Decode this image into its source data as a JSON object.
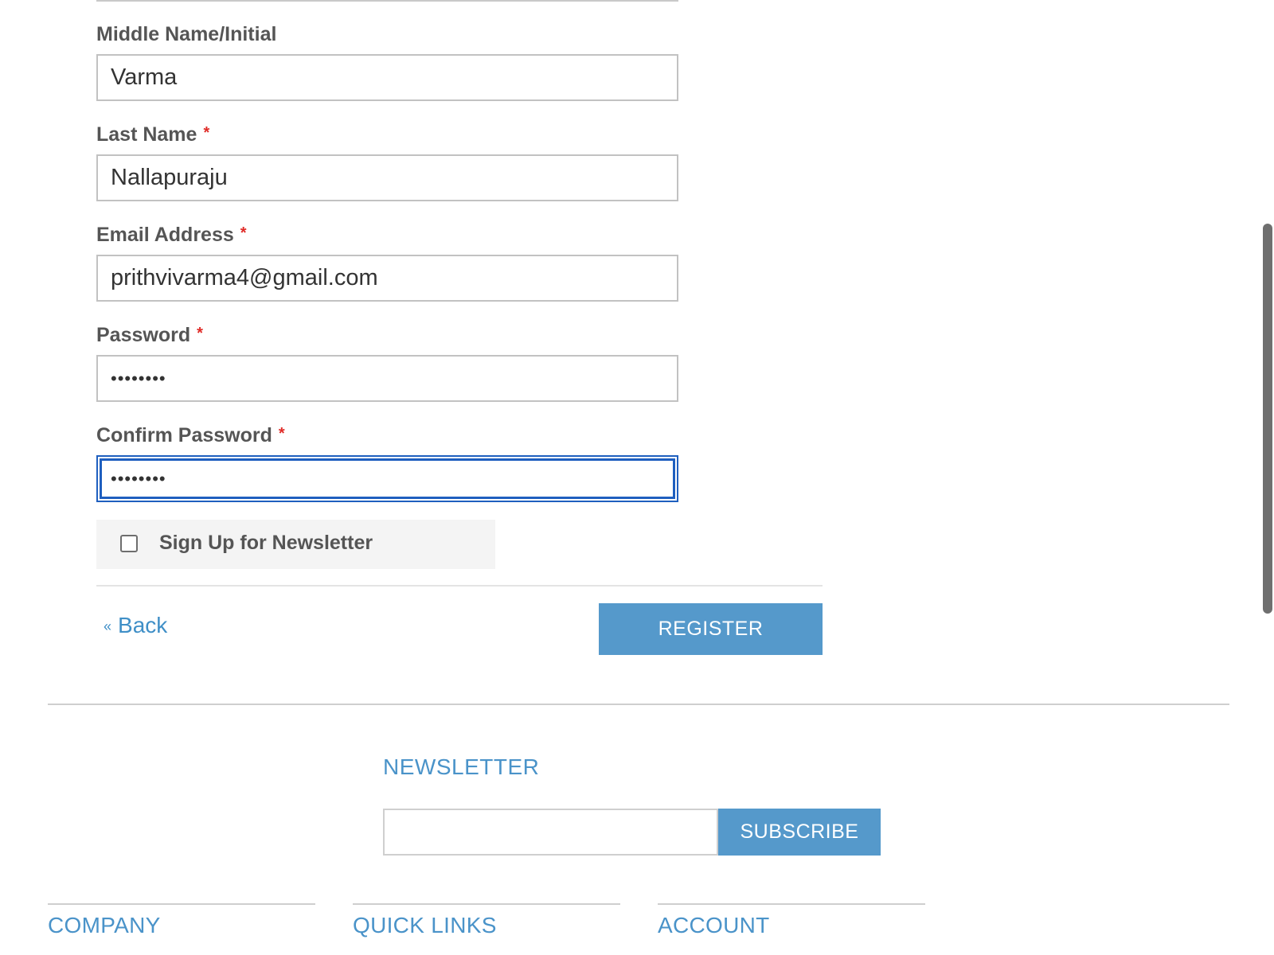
{
  "form": {
    "fields": [
      {
        "label": "Middle Name/Initial",
        "required": false,
        "value": "Varma",
        "type": "text"
      },
      {
        "label": "Last Name",
        "required": true,
        "value": "Nallapuraju",
        "type": "text"
      },
      {
        "label": "Email Address",
        "required": true,
        "value": "prithvivarma4@gmail.com",
        "type": "email"
      },
      {
        "label": "Password",
        "required": true,
        "value": "••••••••",
        "type": "password"
      },
      {
        "label": "Confirm Password",
        "required": true,
        "value": "••••••••",
        "type": "password",
        "focused": true
      }
    ],
    "required_marker": "*",
    "newsletter_checkbox": {
      "label": "Sign Up for Newsletter",
      "checked": false
    },
    "back_link": {
      "chevron": "«",
      "label": "Back"
    },
    "register_label": "REGISTER"
  },
  "footer": {
    "newsletter_heading": "NEWSLETTER",
    "subscribe_placeholder": "",
    "subscribe_label": "SUBSCRIBE",
    "columns": [
      {
        "title": "COMPANY"
      },
      {
        "title": "QUICK LINKS"
      },
      {
        "title": "ACCOUNT"
      }
    ]
  },
  "colors": {
    "accent": "#5599cb",
    "link": "#3f8fc7",
    "required": "#e02b27",
    "focus": "#1f5fbf"
  }
}
